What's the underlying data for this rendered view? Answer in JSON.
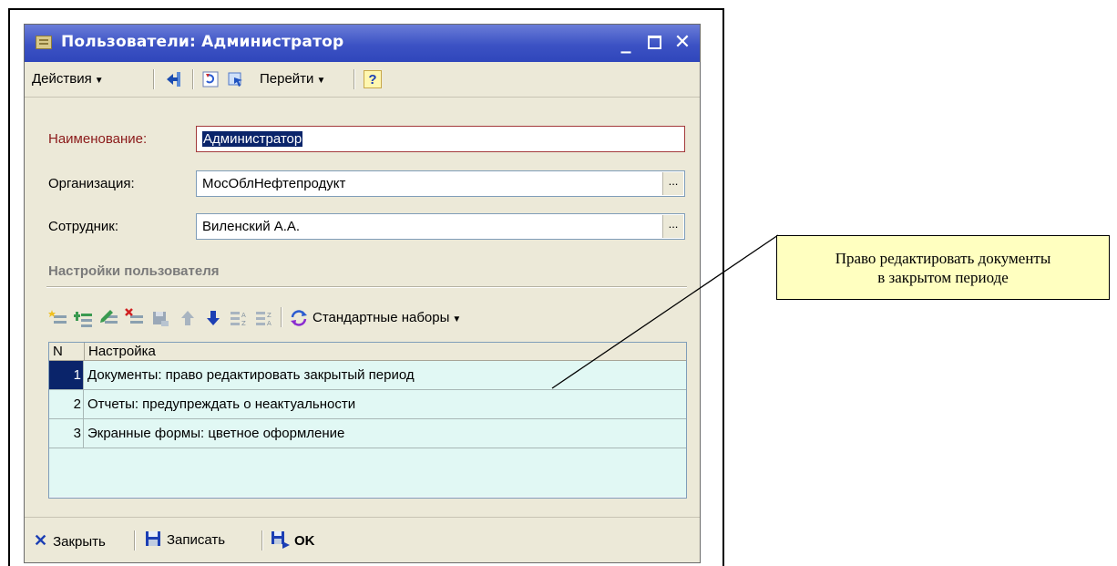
{
  "window": {
    "title": "Пользователи: Администратор",
    "controls": {
      "minimize": "_",
      "close": "✕"
    }
  },
  "toolbar": {
    "actions_label": "Действия",
    "goto_label": "Перейти",
    "help_label": "?",
    "icons": [
      "enter-arrow-icon",
      "refresh-icon",
      "structure-navigate-icon"
    ]
  },
  "form": {
    "name_label": "Наименование:",
    "name_value": "Администратор",
    "org_label": "Организация:",
    "org_value": "МосОблНефтепродукт",
    "employee_label": "Сотрудник:",
    "employee_value": "Виленский А.А.",
    "select_btn": "..."
  },
  "settings": {
    "group_title": "Настройки пользователя",
    "toolbar": {
      "standard_sets_label": "Стандартные наборы",
      "icons": [
        "add-row-icon",
        "add-child-row-icon",
        "edit-row-icon",
        "delete-row-icon",
        "save-row-icon",
        "move-up-icon",
        "move-down-icon",
        "sort-asc-icon",
        "sort-desc-icon",
        "standard-sets-icon"
      ]
    },
    "columns": {
      "n": "N",
      "setting": "Настройка"
    },
    "rows": [
      {
        "n": "1",
        "text": "Документы: право редактировать закрытый период"
      },
      {
        "n": "2",
        "text": "Отчеты: предупреждать о неактуальности"
      },
      {
        "n": "3",
        "text": "Экранные формы: цветное оформление"
      }
    ]
  },
  "bottom_bar": {
    "close_label": "Закрыть",
    "save_label": "Записать",
    "ok_label": "OK"
  },
  "callout": {
    "line1": "Право редактировать документы",
    "line2": "в закрытом периоде"
  },
  "colors": {
    "title_bar": "#3c52c4",
    "name_label": "#8b1a1a",
    "grid_row": "#e1f8f4",
    "selection": "#0a246a",
    "callout_bg": "#ffffc0"
  }
}
